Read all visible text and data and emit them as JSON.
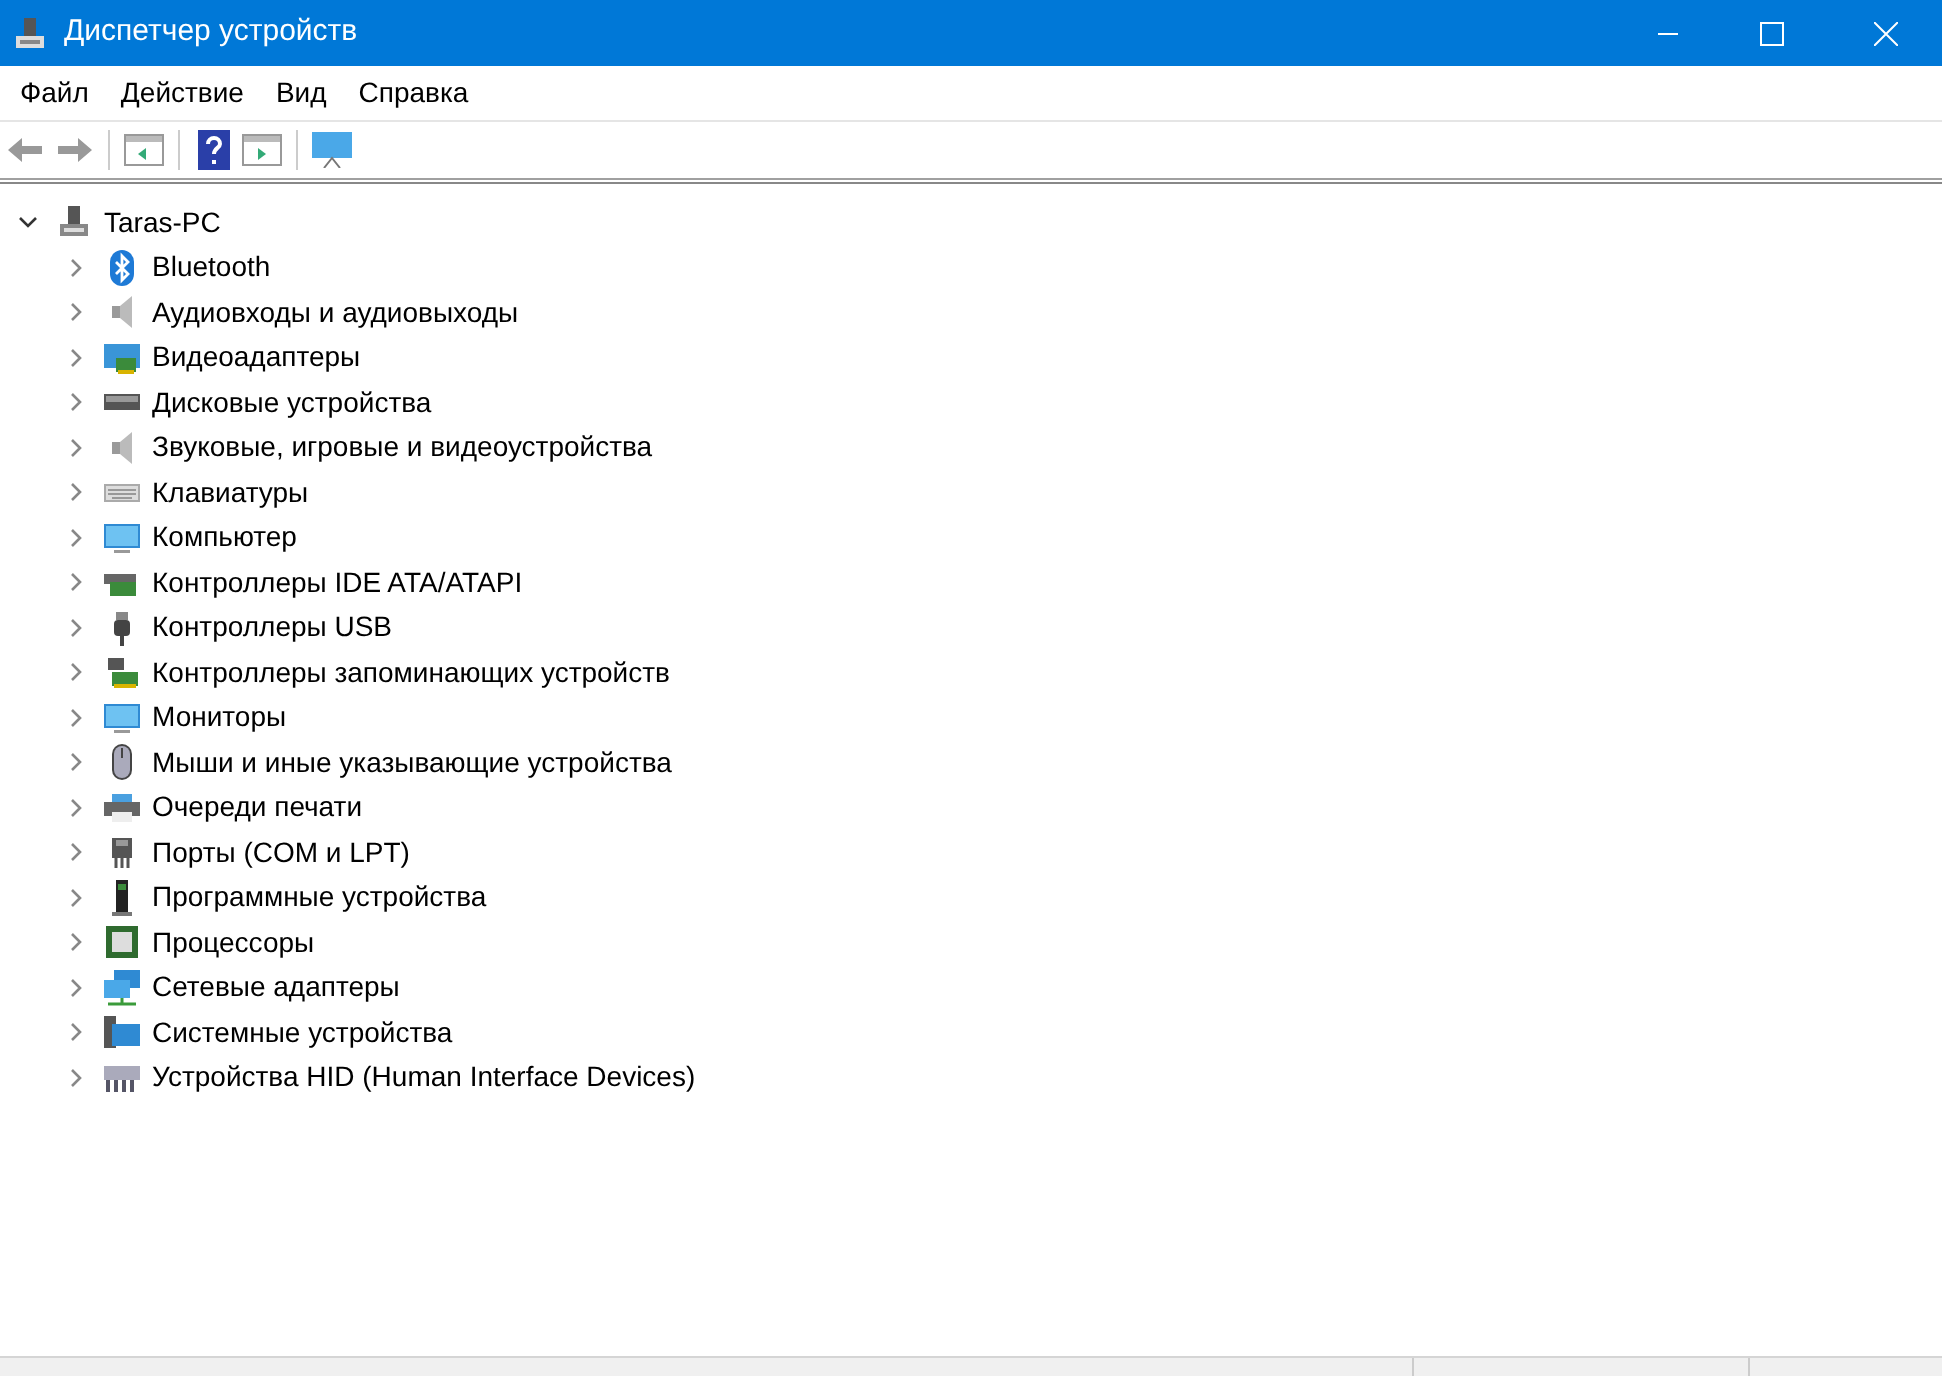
{
  "window": {
    "title": "Диспетчер устройств"
  },
  "menu": [
    "Файл",
    "Действие",
    "Вид",
    "Справка"
  ],
  "toolbar": [
    {
      "kind": "back",
      "disabled": true
    },
    {
      "kind": "forward",
      "disabled": true
    },
    {
      "kind": "separator"
    },
    {
      "kind": "panel-left",
      "disabled": false
    },
    {
      "kind": "separator"
    },
    {
      "kind": "help",
      "disabled": false
    },
    {
      "kind": "panel-right",
      "disabled": false
    },
    {
      "kind": "separator"
    },
    {
      "kind": "monitor",
      "disabled": false
    }
  ],
  "tree": {
    "label": "Taras-PC",
    "kind": "computer",
    "expanded": true,
    "children": [
      {
        "label": "Bluetooth",
        "kind": "bluetooth",
        "expanded": false
      },
      {
        "label": "Аудиовходы и аудиовыходы",
        "kind": "speaker",
        "expanded": false
      },
      {
        "label": "Видеоадаптеры",
        "kind": "display",
        "expanded": false
      },
      {
        "label": "Дисковые устройства",
        "kind": "disk",
        "expanded": false
      },
      {
        "label": "Звуковые, игровые и видеоустройства",
        "kind": "speaker",
        "expanded": false
      },
      {
        "label": "Клавиатуры",
        "kind": "keyboard",
        "expanded": false
      },
      {
        "label": "Компьютер",
        "kind": "monitor",
        "expanded": false
      },
      {
        "label": "Контроллеры IDE ATA/ATAPI",
        "kind": "card",
        "expanded": false
      },
      {
        "label": "Контроллеры USB",
        "kind": "usb",
        "expanded": false
      },
      {
        "label": "Контроллеры запоминающих устройств",
        "kind": "storage",
        "expanded": false
      },
      {
        "label": "Мониторы",
        "kind": "monitor",
        "expanded": false
      },
      {
        "label": "Мыши и иные указывающие устройства",
        "kind": "mouse",
        "expanded": false
      },
      {
        "label": "Очереди печати",
        "kind": "printer",
        "expanded": false
      },
      {
        "label": "Порты (COM и LPT)",
        "kind": "port",
        "expanded": false
      },
      {
        "label": "Программные устройства",
        "kind": "tower",
        "expanded": false
      },
      {
        "label": "Процессоры",
        "kind": "cpu",
        "expanded": false
      },
      {
        "label": "Сетевые адаптеры",
        "kind": "network",
        "expanded": false
      },
      {
        "label": "Системные устройства",
        "kind": "system",
        "expanded": false
      },
      {
        "label": "Устройства HID (Human Interface Devices)",
        "kind": "hid",
        "expanded": false
      }
    ]
  }
}
